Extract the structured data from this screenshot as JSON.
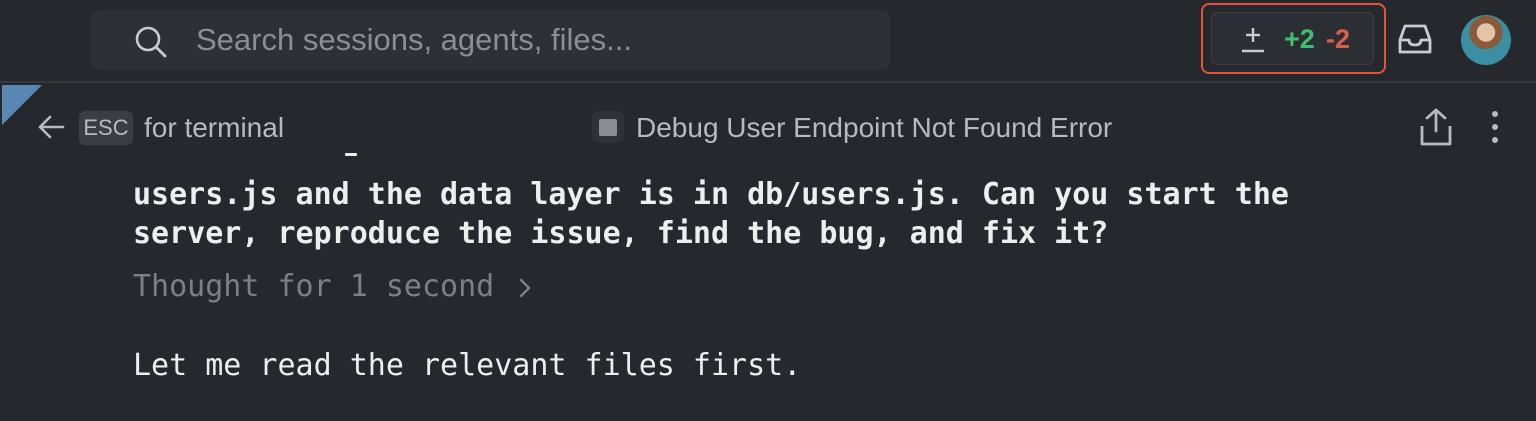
{
  "header": {
    "search_placeholder": "Search sessions, agents, files...",
    "diff": {
      "added": "+2",
      "removed": "-2"
    },
    "colors": {
      "added": "#3fbf6f",
      "removed": "#d9604f",
      "highlight": "#e2533a"
    },
    "icons": [
      "search-icon",
      "plus-minus-icon",
      "inbox-icon",
      "avatar"
    ]
  },
  "session": {
    "esc_key": "ESC",
    "esc_hint": "for terminal",
    "title": "Debug User Endpoint Not Found Error",
    "icons": [
      "back-arrow-icon",
      "stop-square-icon",
      "share-icon",
      "more-vertical-icon"
    ]
  },
  "conversation": {
    "user_message_lines": [
      "users.js and the data layer is in db/users.js. Can you start the",
      "server, reproduce the issue, find the bug, and fix it?"
    ],
    "thought": "Thought for 1 second",
    "reply": "Let me read the relevant files first."
  }
}
